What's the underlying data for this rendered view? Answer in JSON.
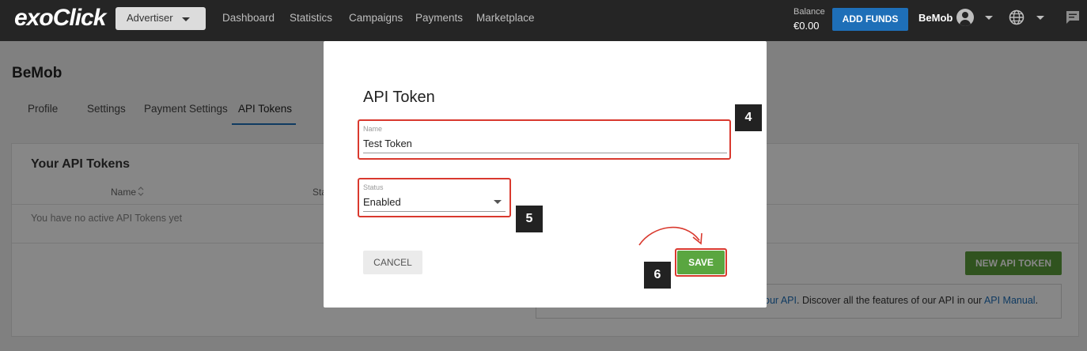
{
  "header": {
    "logo": "exoClick",
    "role_select": "Advertiser",
    "nav": [
      "Dashboard",
      "Statistics",
      "Campaigns",
      "Payments",
      "Marketplace"
    ],
    "balance_label": "Balance",
    "balance_value": "€0.00",
    "add_funds": "ADD FUNDS",
    "user_name": "BeMob"
  },
  "page": {
    "title": "BeMob",
    "tabs": [
      "Profile",
      "Settings",
      "Payment Settings",
      "API Tokens"
    ],
    "active_tab": "API Tokens",
    "card_title": "Your API Tokens",
    "columns": [
      "Name",
      "Sta"
    ],
    "empty_text": "You have no active API Tokens yet",
    "new_token_button": "NEW API TOKEN",
    "info": {
      "link1": "our API",
      "text": ". Discover all the features of our API in our ",
      "link2": "API Manual",
      "end": "."
    }
  },
  "modal": {
    "title": "API Token",
    "name_label": "Name",
    "name_value": "Test Token",
    "status_label": "Status",
    "status_value": "Enabled",
    "cancel": "CANCEL",
    "save": "SAVE"
  },
  "steps": [
    "4",
    "5",
    "6"
  ],
  "colors": {
    "topbar": "#252525",
    "primary": "#1e6fb8",
    "success": "#5aa640",
    "highlight": "#d9392e"
  }
}
